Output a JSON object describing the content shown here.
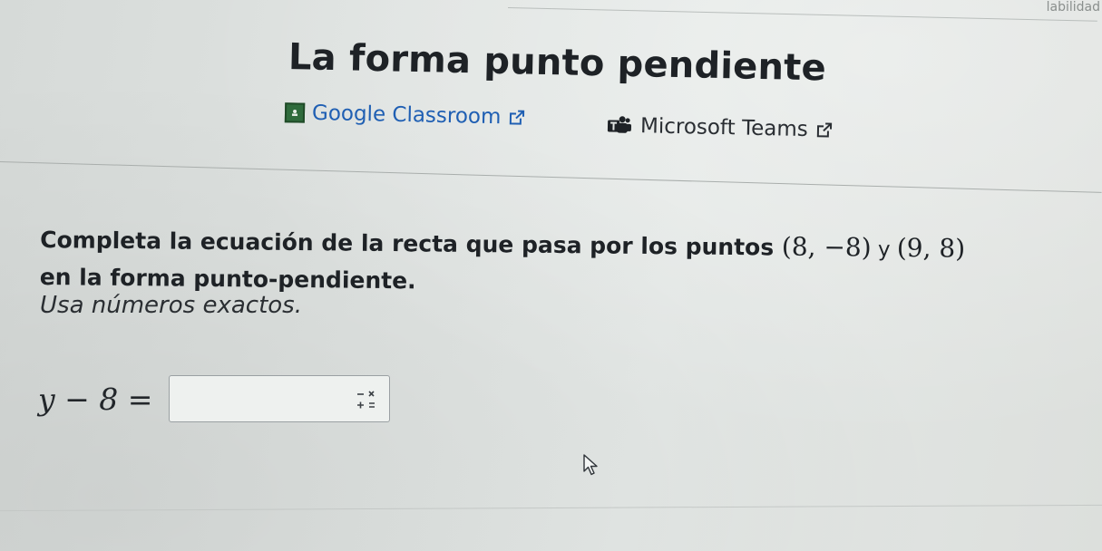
{
  "page": {
    "corner_text": "labilidad",
    "title": "La forma punto pendiente"
  },
  "share": {
    "google_classroom": {
      "label": "Google Classroom",
      "icon": "google-classroom-icon",
      "color": "#1f5fb3"
    },
    "microsoft_teams": {
      "label": "Microsoft Teams",
      "icon": "microsoft-teams-icon",
      "color": "#2a2e33"
    }
  },
  "question": {
    "text_before": "Completa la ecuación de la recta que pasa por los puntos ",
    "point1": "(8, −8)",
    "conjunction": " y ",
    "point2": "(9, 8)",
    "text_line2": "en la forma punto-pendiente.",
    "hint": "Usa números exactos."
  },
  "equation": {
    "lhs": "y − 8 =",
    "answer_value": "",
    "keypad_icon": "math-keypad-icon"
  },
  "cursor_icon": "mouse-pointer-icon"
}
